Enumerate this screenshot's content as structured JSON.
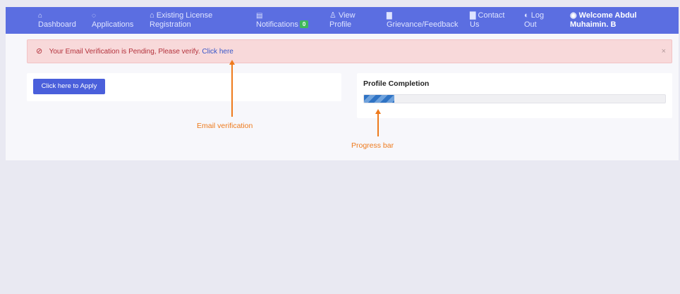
{
  "nav": {
    "dashboard": {
      "icon": "home-icon",
      "glyph": "⌂",
      "label": "Dashboard"
    },
    "applications": {
      "icon": "tag-icon",
      "glyph": "◌",
      "label": "Applications"
    },
    "existing_license": {
      "icon": "building-icon",
      "glyph": "⌂",
      "line1": "Existing License",
      "line2": "Registration"
    },
    "notifications": {
      "icon": "calendar-icon",
      "glyph": "▤",
      "label": "Notifications",
      "count": "0"
    },
    "view_profile": {
      "icon": "user-icon",
      "glyph": "♙",
      "line1": "View",
      "line2": "Profile"
    },
    "grievance": {
      "icon": "document-icon",
      "glyph": "▇",
      "label": "Grievance/Feedback"
    },
    "contact": {
      "icon": "document-icon",
      "glyph": "▇",
      "line1": "Contact",
      "line2": "Us"
    },
    "logout": {
      "icon": "power-icon",
      "glyph": "◐",
      "line1": "Log",
      "line2": "Out"
    },
    "welcome": {
      "icon": "user-circle-icon",
      "glyph": "◉",
      "line1": "Welcome Abdul",
      "line2": "Muhaimin. B"
    }
  },
  "alert": {
    "icon": "ban-icon",
    "glyph": "⊘",
    "message": "Your Email Verification is Pending, Please verify.",
    "link_label": "Click here",
    "close_glyph": "×"
  },
  "apply": {
    "button_label": "Click here to Apply"
  },
  "profile": {
    "title": "Profile Completion",
    "progress_fraction": 0.1
  },
  "annotations": {
    "email": "Email verification",
    "progress": "Progress bar"
  },
  "colors": {
    "navbar": "#5b6ee1",
    "accent_button": "#4a5fdb",
    "alert_bg": "#f8d9da",
    "alert_text": "#b3313b",
    "annotation": "#ee7a1c",
    "badge": "#3fb95a"
  }
}
